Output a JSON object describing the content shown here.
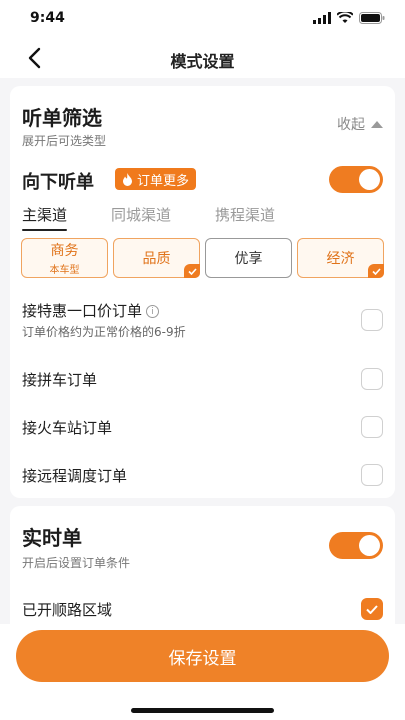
{
  "status": {
    "time": "9:44"
  },
  "nav": {
    "title": "模式设置"
  },
  "listen_filter": {
    "title": "听单筛选",
    "subtitle": "展开后可选类型",
    "collapse_label": "收起"
  },
  "downward": {
    "label": "向下听单",
    "badge": "订单更多",
    "toggle_on": true
  },
  "tabs": [
    {
      "label": "主渠道",
      "active": true
    },
    {
      "label": "同城渠道",
      "active": false
    },
    {
      "label": "携程渠道",
      "active": false
    }
  ],
  "car_types": [
    {
      "label": "商务",
      "sub": "本车型",
      "checked": false
    },
    {
      "label": "品质",
      "sub": "",
      "checked": true
    },
    {
      "label": "优享",
      "sub": "",
      "checked": false
    },
    {
      "label": "经济",
      "sub": "",
      "checked": true
    }
  ],
  "order_options": [
    {
      "label": "接特惠一口价订单",
      "sub": "订单价格约为正常价格的6-9折",
      "checked": false
    },
    {
      "label": "接拼车订单",
      "sub": "",
      "checked": false
    },
    {
      "label": "接火车站订单",
      "sub": "",
      "checked": false
    },
    {
      "label": "接远程调度订单",
      "sub": "",
      "checked": false
    }
  ],
  "realtime": {
    "title": "实时单",
    "subtitle": "开启后设置订单条件",
    "toggle_on": true,
    "route_label": "已开顺路区域",
    "route_checked": true
  },
  "footer": {
    "save_label": "保存设置"
  },
  "colors": {
    "accent": "#ef7c21",
    "background": "#f5f5f7"
  }
}
